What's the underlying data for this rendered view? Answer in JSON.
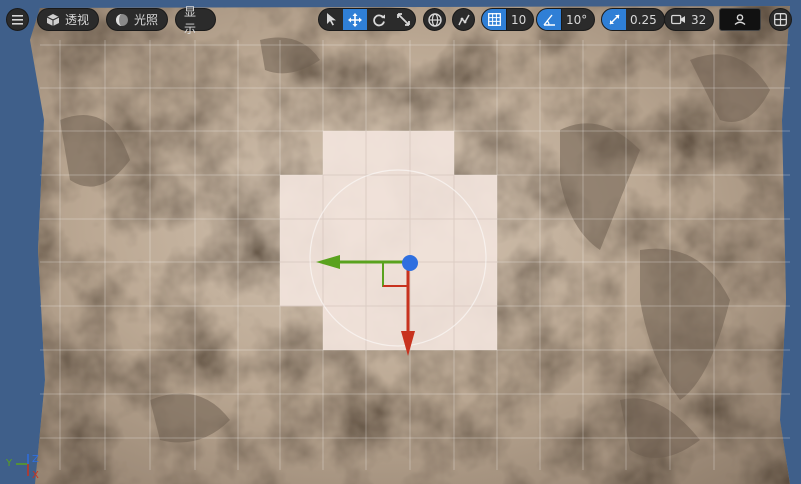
{
  "toolbar": {
    "menu_icon": "hamburger-icon",
    "perspective_label": "透视",
    "lighting_label": "光照",
    "show_label": "显示",
    "grid_snap_value": "10",
    "rotation_snap_value": "10°",
    "scale_snap_value": "0.25",
    "camera_speed_value": "32",
    "tools": [
      "select-icon",
      "move-icon",
      "rotate-icon",
      "scale-icon"
    ],
    "accent_color": "#2f7fd6"
  },
  "axis_indicator": {
    "y": "Y",
    "z": "Z",
    "x": "X"
  },
  "colors": {
    "gizmo_x": "#c8321e",
    "gizmo_y": "#5aa21e",
    "gizmo_center": "#2f6fe0",
    "terrain": "#b7a592",
    "background": "#3f5f8a"
  }
}
